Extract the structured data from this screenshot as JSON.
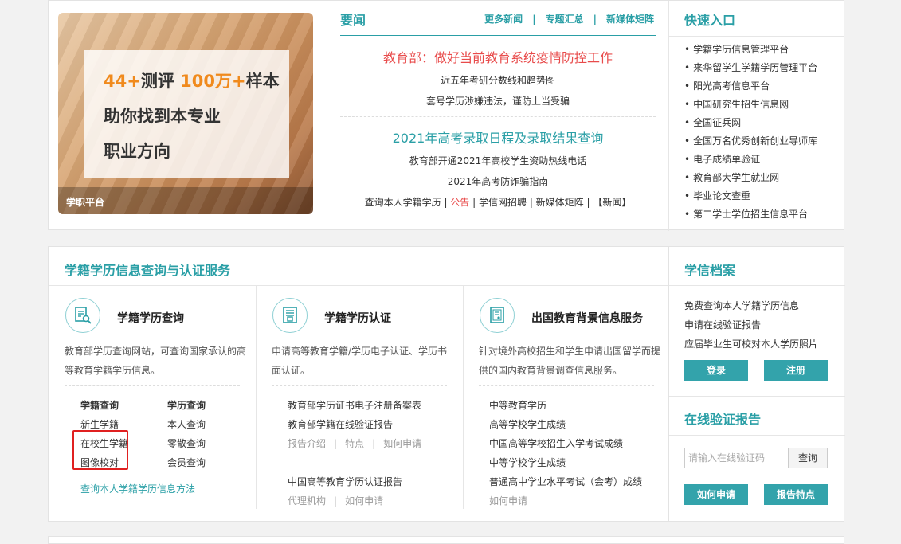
{
  "banner": {
    "line1_num1": "44+",
    "line1_text1": "测评 ",
    "line1_num2": "100万+",
    "line1_text2": "样本",
    "line2": "助你找到本专业",
    "line3": "职业方向",
    "footer": "学职平台",
    "slide_count": 3,
    "active_slide": 3
  },
  "news": {
    "title": "要闻",
    "links": [
      "更多新闻",
      "专题汇总",
      "新媒体矩阵"
    ],
    "headline1": "教育部：做好当前教育系统疫情防控工作",
    "items1": [
      "近五年考研分数线和趋势图",
      "套号学历涉嫌违法，谨防上当受骗"
    ],
    "headline2": "2021年高考录取日程及录取结果查询",
    "items2": [
      "教育部开通2021年高校学生资助热线电话",
      "2021年高考防诈骗指南"
    ],
    "bottom_links": [
      "查询本人学籍学历",
      "公告",
      "学信网招聘",
      "新媒体矩阵",
      "【新闻】"
    ]
  },
  "quick": {
    "title": "快速入口",
    "items": [
      "学籍学历信息管理平台",
      "来华留学生学籍学历管理平台",
      "阳光高考信息平台",
      "中国研究生招生信息网",
      "全国征兵网",
      "全国万名优秀创新创业导师库",
      "电子成绩单验证",
      "教育部大学生就业网",
      "毕业论文查重",
      "第二学士学位招生信息平台"
    ]
  },
  "main": {
    "title": "学籍学历信息查询与认证服务",
    "col1": {
      "title": "学籍学历查询",
      "desc": "教育部学历查询网站，可查询国家承认的高等教育学籍学历信息。",
      "links_left": [
        "学籍查询",
        "新生学籍",
        "在校生学籍",
        "图像校对"
      ],
      "links_right": [
        "学历查询",
        "本人查询",
        "零散查询",
        "会员查询"
      ],
      "bottom_link": "查询本人学籍学历信息方法"
    },
    "col2": {
      "title": "学籍学历认证",
      "desc": "申请高等教育学籍/学历电子认证、学历书面认证。",
      "link1": "教育部学历证书电子注册备案表",
      "link2": "教育部学籍在线验证报告",
      "sub1": [
        "报告介绍",
        "特点",
        "如何申请"
      ],
      "link3": "中国高等教育学历认证报告",
      "sub2": [
        "代理机构",
        "如何申请"
      ]
    },
    "col3": {
      "title": "出国教育背景信息服务",
      "desc": "针对境外高校招生和学生申请出国留学而提供的国内教育背景调查信息服务。",
      "links": [
        "中等教育学历",
        "高等学校学生成绩",
        "中国高等学校招生入学考试成绩",
        "中等学校学生成绩",
        "普通高中学业水平考试（会考）成绩"
      ],
      "apply": "如何申请"
    }
  },
  "archive": {
    "title": "学信档案",
    "items": [
      "免费查询本人学籍学历信息",
      "申请在线验证报告",
      "应届毕业生可校对本人学历照片"
    ],
    "login": "登录",
    "register": "注册"
  },
  "verify": {
    "title": "在线验证报告",
    "placeholder": "请输入在线验证码",
    "query": "查询",
    "how_to_apply": "如何申请",
    "report_features": "报告特点"
  },
  "colors": {
    "accent": "#2a9fa6",
    "orange": "#f08a1d",
    "red": "#e84b4b",
    "highlight_box": "#e02020"
  }
}
